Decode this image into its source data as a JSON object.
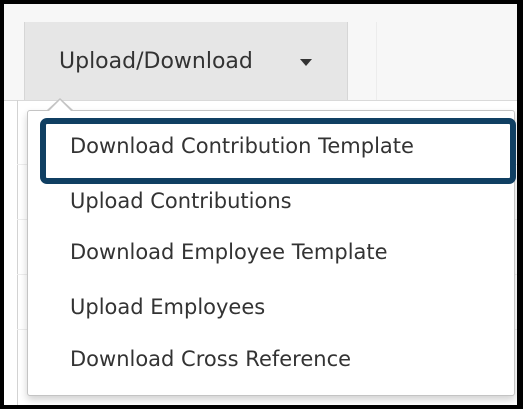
{
  "toolbar": {
    "upload_download_label": "Upload/Download"
  },
  "menu": {
    "items": [
      {
        "label": "Download Contribution Template"
      },
      {
        "label": "Upload Contributions"
      },
      {
        "label": "Download Employee Template"
      },
      {
        "label": "Upload Employees"
      },
      {
        "label": "Download Cross Reference"
      }
    ]
  },
  "colors": {
    "highlight_border": "#103f62",
    "text": "#333333",
    "tab_background": "#e6e6e6"
  },
  "icons": {
    "dropdown_caret": "caret-down-icon"
  }
}
